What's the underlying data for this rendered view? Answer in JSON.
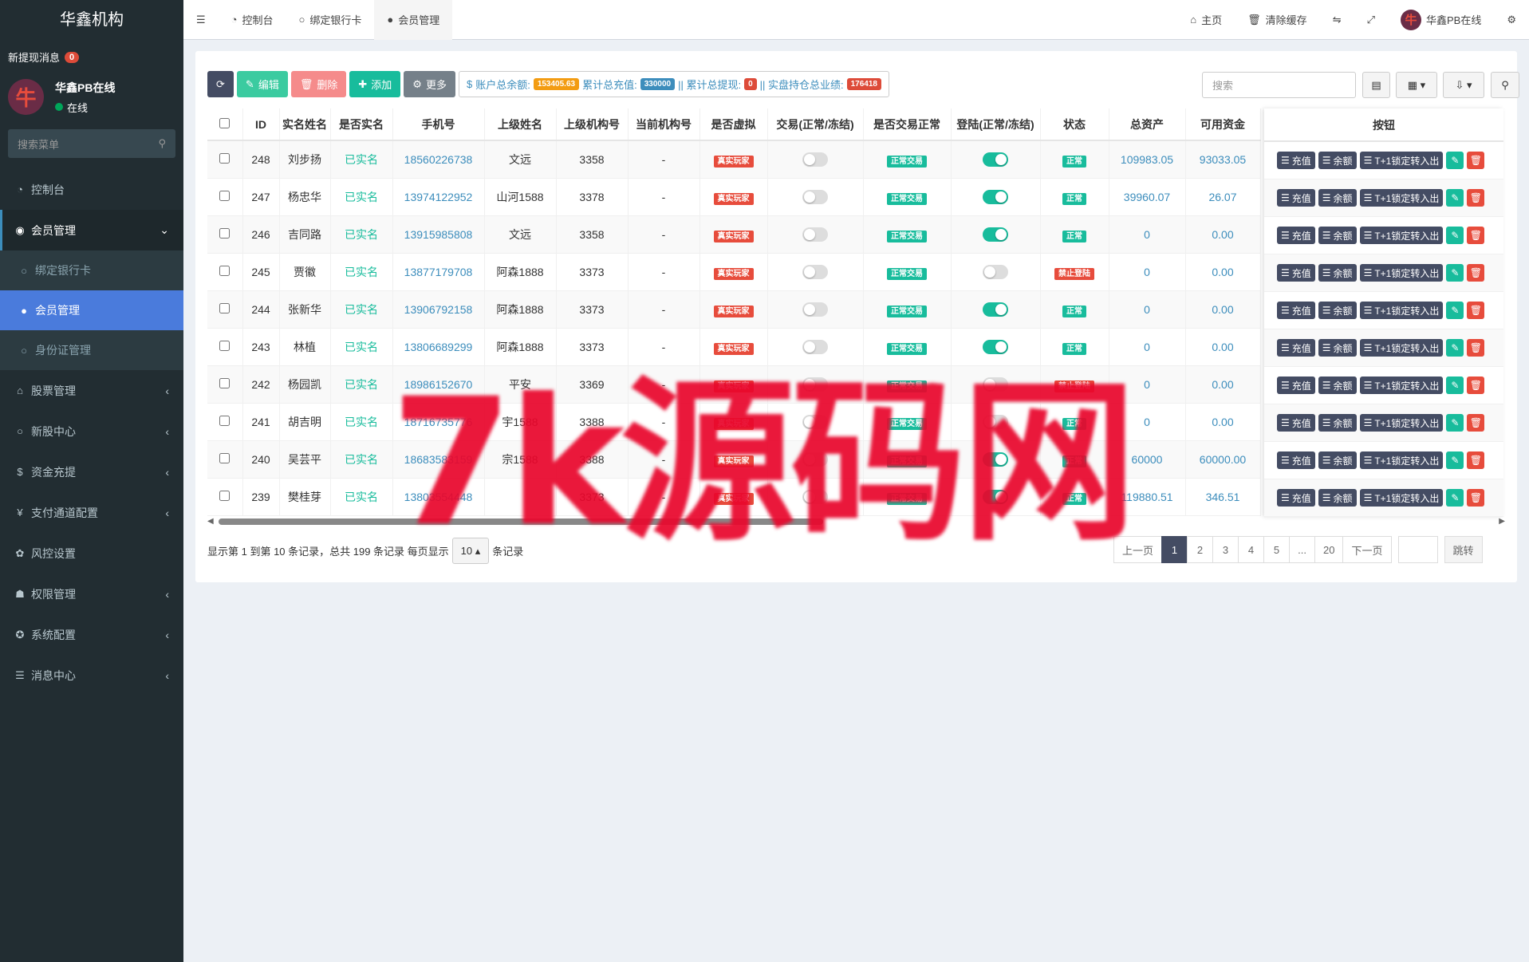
{
  "sidebar": {
    "brand": "华鑫机构",
    "notice_label": "新提现消息",
    "notice_count": "0",
    "user_name": "华鑫PB在线",
    "user_status": "在线",
    "search_placeholder": "搜索菜单",
    "items": [
      {
        "label": "控制台",
        "icon": "dashboard-icon"
      },
      {
        "label": "会员管理",
        "icon": "user-circle-icon"
      },
      {
        "label": "绑定银行卡",
        "icon": "circle-icon"
      },
      {
        "label": "会员管理",
        "icon": "user-icon"
      },
      {
        "label": "身份证管理",
        "icon": "circle-icon"
      },
      {
        "label": "股票管理",
        "icon": "bank-icon"
      },
      {
        "label": "新股中心",
        "icon": "circle-icon"
      },
      {
        "label": "资金充提",
        "icon": "dollar-icon"
      },
      {
        "label": "支付通道配置",
        "icon": "yen-icon"
      },
      {
        "label": "风控设置",
        "icon": "gear-icon"
      },
      {
        "label": "权限管理",
        "icon": "group-icon"
      },
      {
        "label": "系统配置",
        "icon": "cog-icon"
      },
      {
        "label": "消息中心",
        "icon": "list-icon"
      }
    ]
  },
  "topbar": {
    "tabs": [
      {
        "label": "控制台",
        "icon": "dashboard-icon"
      },
      {
        "label": "绑定银行卡",
        "icon": "circle-icon"
      },
      {
        "label": "会员管理",
        "icon": "user-icon"
      }
    ],
    "home": "主页",
    "clear_cache": "清除缓存",
    "user": "华鑫PB在线"
  },
  "toolbar": {
    "edit": "编辑",
    "delete": "删除",
    "add": "添加",
    "more": "更多",
    "acct_label": "账户总余额:",
    "acct_value": "153405.63",
    "recharge_label": "累计总充值:",
    "recharge_value": "330000",
    "withdraw_label": "|| 累计总提现:",
    "withdraw_value": "0",
    "position_label": "|| 实盘持仓总业绩:",
    "position_value": "176418",
    "search_placeholder": "搜索"
  },
  "table": {
    "headers": [
      "ID",
      "实名姓名",
      "是否实名",
      "手机号",
      "上级姓名",
      "上级机构号",
      "当前机构号",
      "是否虚拟",
      "交易(正常/冻结)",
      "是否交易正常",
      "登陆(正常/冻结)",
      "状态",
      "总资产",
      "可用资金"
    ],
    "ops_header": "按钮",
    "rows": [
      {
        "id": "248",
        "name": "刘步扬",
        "real": "已实名",
        "phone": "18560226738",
        "parent": "文远",
        "porg": "3358",
        "org": "-",
        "virt": "真实玩家",
        "trade_on": false,
        "trade_status": "正常交易",
        "login_on": true,
        "status": "正常",
        "status_type": "green",
        "total": "109983.05",
        "avail": "93033.05"
      },
      {
        "id": "247",
        "name": "杨忠华",
        "real": "已实名",
        "phone": "13974122952",
        "parent": "山河1588",
        "porg": "3378",
        "org": "-",
        "virt": "真实玩家",
        "trade_on": false,
        "trade_status": "正常交易",
        "login_on": true,
        "status": "正常",
        "status_type": "green",
        "total": "39960.07",
        "avail": "26.07"
      },
      {
        "id": "246",
        "name": "吉同路",
        "real": "已实名",
        "phone": "13915985808",
        "parent": "文远",
        "porg": "3358",
        "org": "-",
        "virt": "真实玩家",
        "trade_on": false,
        "trade_status": "正常交易",
        "login_on": true,
        "status": "正常",
        "status_type": "green",
        "total": "0",
        "avail": "0.00"
      },
      {
        "id": "245",
        "name": "贾徽",
        "real": "已实名",
        "phone": "13877179708",
        "parent": "阿森1888",
        "porg": "3373",
        "org": "-",
        "virt": "真实玩家",
        "trade_on": false,
        "trade_status": "正常交易",
        "login_on": false,
        "status": "禁止登陆",
        "status_type": "red",
        "total": "0",
        "avail": "0.00"
      },
      {
        "id": "244",
        "name": "张新华",
        "real": "已实名",
        "phone": "13906792158",
        "parent": "阿森1888",
        "porg": "3373",
        "org": "-",
        "virt": "真实玩家",
        "trade_on": false,
        "trade_status": "正常交易",
        "login_on": true,
        "status": "正常",
        "status_type": "green",
        "total": "0",
        "avail": "0.00"
      },
      {
        "id": "243",
        "name": "林植",
        "real": "已实名",
        "phone": "13806689299",
        "parent": "阿森1888",
        "porg": "3373",
        "org": "-",
        "virt": "真实玩家",
        "trade_on": false,
        "trade_status": "正常交易",
        "login_on": true,
        "status": "正常",
        "status_type": "green",
        "total": "0",
        "avail": "0.00"
      },
      {
        "id": "242",
        "name": "杨园凯",
        "real": "已实名",
        "phone": "18986152670",
        "parent": "平安",
        "porg": "3369",
        "org": "-",
        "virt": "真实玩家",
        "trade_on": false,
        "trade_status": "正常交易",
        "login_on": false,
        "status": "禁止登陆",
        "status_type": "red",
        "total": "0",
        "avail": "0.00"
      },
      {
        "id": "241",
        "name": "胡吉明",
        "real": "已实名",
        "phone": "18716735776",
        "parent": "宇1588",
        "porg": "3388",
        "org": "-",
        "virt": "真实玩家",
        "trade_on": false,
        "trade_status": "正常交易",
        "login_on": false,
        "status": "正常",
        "status_type": "green",
        "total": "0",
        "avail": "0.00"
      },
      {
        "id": "240",
        "name": "吴芸平",
        "real": "已实名",
        "phone": "18683583159",
        "parent": "宗1588",
        "porg": "3388",
        "org": "-",
        "virt": "真实玩家",
        "trade_on": false,
        "trade_status": "正常交易",
        "login_on": true,
        "status": "正常",
        "status_type": "green",
        "total": "60000",
        "avail": "60000.00"
      },
      {
        "id": "239",
        "name": "樊桂芽",
        "real": "已实名",
        "phone": "13803554448",
        "parent": "",
        "porg": "3373",
        "org": "-",
        "virt": "真实玩家",
        "trade_on": false,
        "trade_status": "正常交易",
        "login_on": true,
        "status": "正常",
        "status_type": "green",
        "total": "119880.51",
        "avail": "346.51"
      }
    ],
    "ops": {
      "recharge": "充值",
      "balance": "余额",
      "t1": "T+1锁定转入出"
    }
  },
  "pagination": {
    "info": "显示第 1 到第 10 条记录，总共 199 条记录 每页显示",
    "page_size": "10",
    "suffix": "条记录",
    "prev": "上一页",
    "pages": [
      "1",
      "2",
      "3",
      "4",
      "5",
      "...",
      "20"
    ],
    "next": "下一页",
    "jump": "跳转"
  },
  "watermark": "7k源码网",
  "colors": {
    "primary": "#444c63",
    "accent": "#18bc9c",
    "danger": "#e74c3c",
    "link": "#3c8dbc",
    "sidebar": "#222d32"
  }
}
